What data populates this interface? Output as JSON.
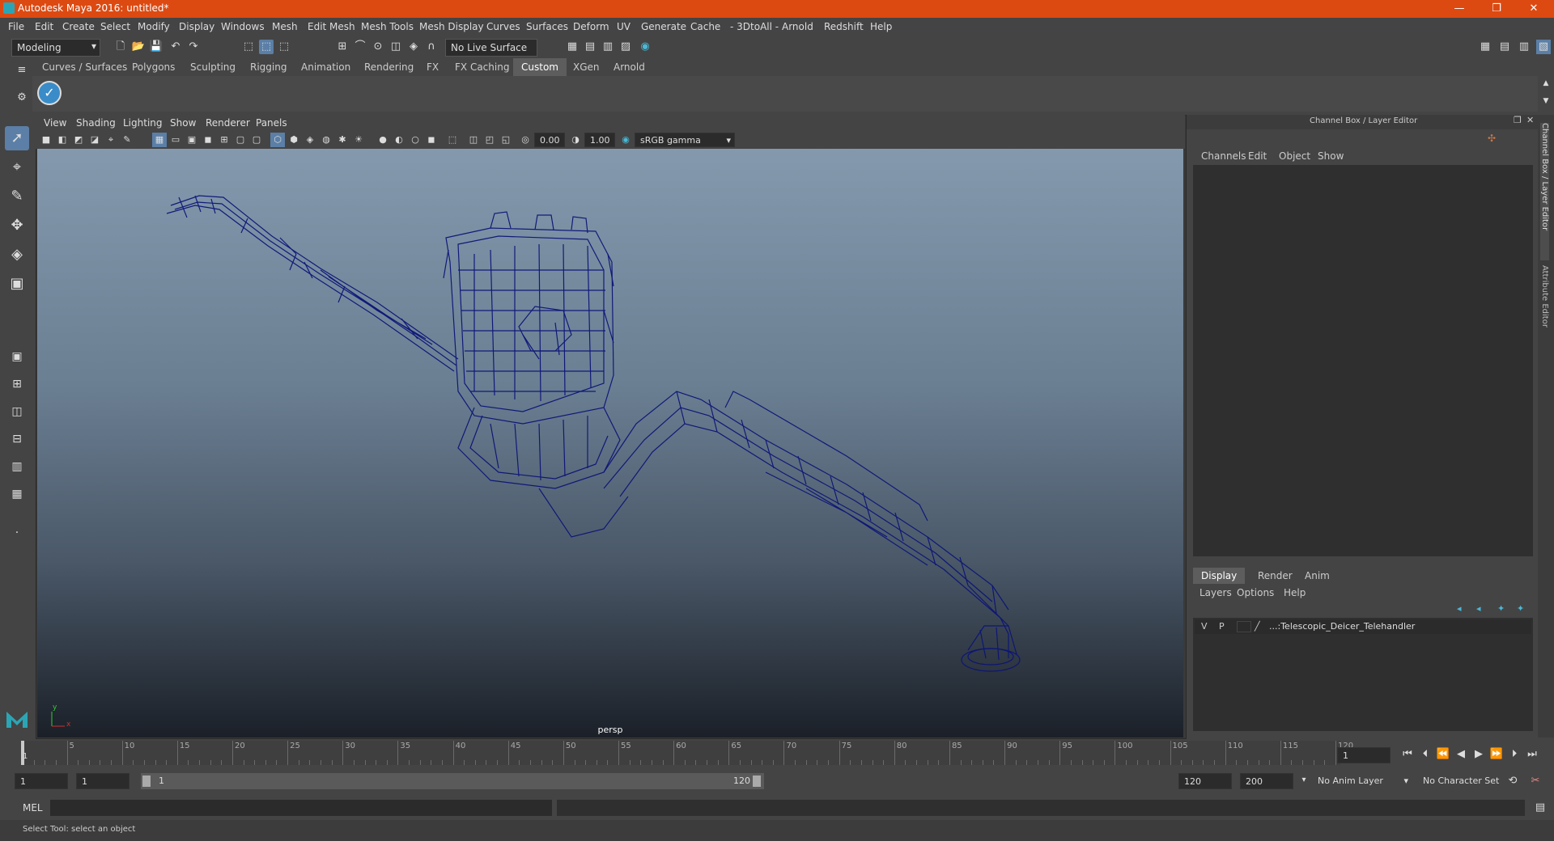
{
  "window": {
    "title": "Autodesk Maya 2016: untitled*",
    "minimize": "—",
    "maximize": "❐",
    "close": "✕"
  },
  "menu": [
    "File",
    "Edit",
    "Create",
    "Select",
    "Modify",
    "Display",
    "Windows",
    "Mesh",
    "Edit Mesh",
    "Mesh Tools",
    "Mesh Display",
    "Curves",
    "Surfaces",
    "Deform",
    "UV",
    "Generate",
    "Cache",
    "- 3DtoAll -",
    "Arnold",
    "Redshift",
    "Help"
  ],
  "status": {
    "mode": "Modeling",
    "live_surface": "No Live Surface"
  },
  "shelf_tabs": [
    "Curves / Surfaces",
    "Polygons",
    "Sculpting",
    "Rigging",
    "Animation",
    "Rendering",
    "FX",
    "FX Caching",
    "Custom",
    "XGen",
    "Arnold"
  ],
  "shelf_active": "Custom",
  "viewport": {
    "menu": [
      "View",
      "Shading",
      "Lighting",
      "Show",
      "Renderer",
      "Panels"
    ],
    "exposure": "0.00",
    "gamma": "1.00",
    "color_space": "sRGB gamma",
    "camera": "persp",
    "axis_x": "x",
    "axis_y": "y"
  },
  "channel_box": {
    "title": "Channel Box / Layer Editor",
    "menu": [
      "Channels",
      "Edit",
      "Object",
      "Show"
    ],
    "layer_tabs": [
      "Display",
      "Render",
      "Anim"
    ],
    "layer_active": "Display",
    "layer_menu": [
      "Layers",
      "Options",
      "Help"
    ],
    "layer": {
      "v": "V",
      "p": "P",
      "name": "...:Telescopic_Deicer_Telehandler"
    },
    "side_tab_1": "Channel Box / Layer Editor",
    "side_tab_2": "Attribute Editor"
  },
  "timeline": {
    "ticks": [
      "1",
      "5",
      "10",
      "15",
      "20",
      "25",
      "30",
      "35",
      "40",
      "45",
      "50",
      "55",
      "60",
      "65",
      "70",
      "75",
      "80",
      "85",
      "90",
      "95",
      "100",
      "105",
      "110",
      "115",
      "120"
    ],
    "current_frame": "1"
  },
  "range": {
    "start": "1",
    "start2": "1",
    "slider_start": "1",
    "slider_end": "120",
    "end": "120",
    "end2": "200",
    "anim_layer": "No Anim Layer",
    "char_set": "No Character Set"
  },
  "cmd": {
    "label": "MEL"
  },
  "help": {
    "text": "Select Tool: select an object"
  },
  "colors": {
    "titlebar": "#dc4a12",
    "wire": "#0c1477"
  }
}
